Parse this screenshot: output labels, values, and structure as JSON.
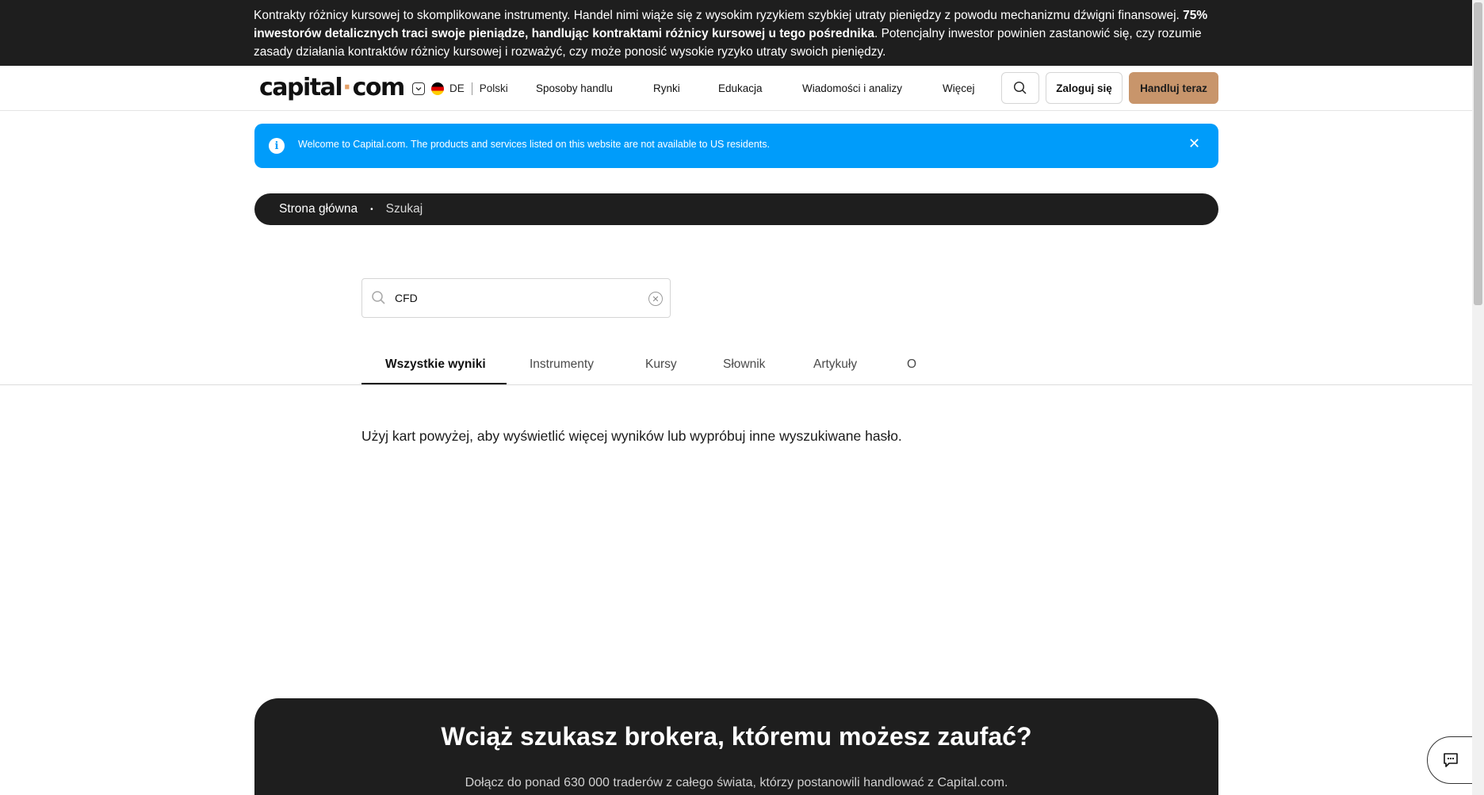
{
  "risk_banner": {
    "text_start": "Kontrakty różnicy kursowej to skomplikowane instrumenty. Handel nimi wiąże się z wysokim ryzykiem szybkiej utraty pieniędzy z powodu mechanizmu dźwigni finansowej. ",
    "text_bold": "75% inwestorów detalicznych traci swoje pieniądze, handlując kontraktami różnicy kursowej u tego pośrednika",
    "text_end": ". Potencjalny inwestor powinien zastanowić się, czy rozumie zasady działania kontraktów różnicy kursowej i rozważyć, czy może ponosić wysokie ryzyko utraty swoich pieniędzy."
  },
  "header": {
    "logo_left": "capital",
    "logo_dot": "·",
    "logo_right": "com",
    "country_code": "DE",
    "language": "Polski",
    "nav": [
      "Sposoby handlu",
      "Rynki",
      "Edukacja",
      "Wiadomości i analizy",
      "Więcej"
    ],
    "login_label": "Zaloguj się",
    "trade_label": "Handluj teraz"
  },
  "info_bar": {
    "icon": "info-icon",
    "text": "Welcome to Capital.com. The products and services listed on this website are not available to US residents.",
    "close": "✕"
  },
  "breadcrumb": {
    "home": "Strona główna",
    "separator": "•",
    "current": "Szukaj"
  },
  "search": {
    "value": "CFD"
  },
  "tabs": [
    "Wszystkie wyniki",
    "Instrumenty",
    "Kursy",
    "Słownik",
    "Artykuły",
    "O"
  ],
  "active_tab": "Wszystkie wyniki",
  "hint": "Użyj kart powyżej, aby wyświetlić więcej wyników lub wypróbuj inne wyszukiwane hasło.",
  "cta": {
    "title": "Wciąż szukasz brokera, któremu możesz zaufać?",
    "subtitle": "Dołącz do ponad 630 000 traderów z całego świata, którzy postanowili handlować z Capital.com."
  },
  "colors": {
    "dark_bg": "#1e1e1e",
    "accent_trade": "#c8956b",
    "info_blue": "#009cfa"
  }
}
